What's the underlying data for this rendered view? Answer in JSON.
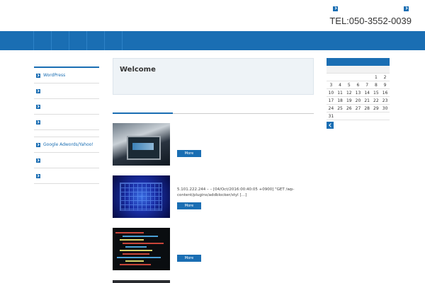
{
  "header": {
    "site_title": "",
    "site_description": "",
    "top_links": [
      "",
      ""
    ],
    "phone_label": "",
    "phone": "TEL:050-3552-0039"
  },
  "nav": {
    "items": [
      "",
      "",
      "",
      "",
      ""
    ]
  },
  "sidebar": {
    "heading": "",
    "items": [
      "WordPress",
      "",
      "",
      ""
    ],
    "items2": [
      "Google Adwords/Yahoo!",
      "",
      ""
    ]
  },
  "welcome": {
    "title": "Welcome",
    "text": ""
  },
  "posts_section": {
    "title": ""
  },
  "posts": [
    {
      "title": "",
      "excerpt": "",
      "more": "More"
    },
    {
      "title": "",
      "excerpt": "5.101.222.244 – – [04/Oct/2016:00:40:05 +0900] \"GET /wp-content/plugins/addblocker/styl […]",
      "more": "More"
    },
    {
      "title": "",
      "excerpt": "",
      "more": "More"
    }
  ],
  "calendar": {
    "month": "",
    "weekdays": [
      "",
      "",
      "",
      "",
      "",
      "",
      ""
    ],
    "weeks": [
      [
        "",
        "",
        "",
        "",
        "",
        "1",
        "2"
      ],
      [
        "3",
        "4",
        "5",
        "6",
        "7",
        "8",
        "9"
      ],
      [
        "10",
        "11",
        "12",
        "13",
        "14",
        "15",
        "16"
      ],
      [
        "17",
        "18",
        "19",
        "20",
        "21",
        "22",
        "23"
      ],
      [
        "24",
        "25",
        "26",
        "27",
        "28",
        "29",
        "30"
      ],
      [
        "31",
        "",
        "",
        "",
        "",
        "",
        ""
      ]
    ]
  },
  "colors": {
    "accent": "#1a6eb3",
    "welcome_bg": "#eef3f7"
  }
}
